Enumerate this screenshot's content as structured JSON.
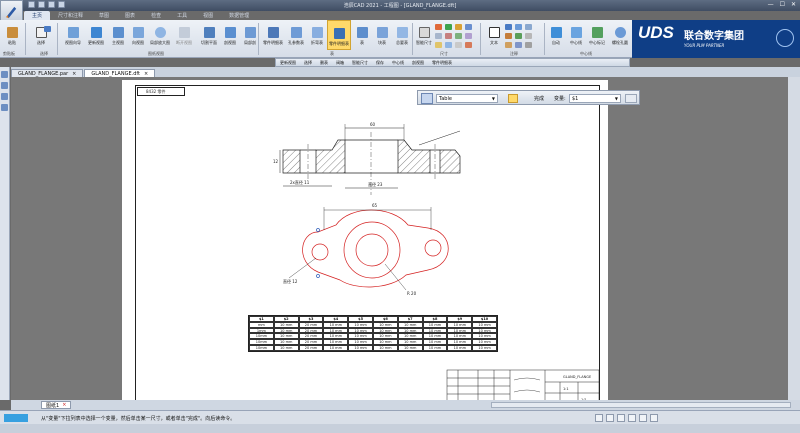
{
  "window": {
    "title": "浩辰CAD 2021 - 工程图 - [GLAND_FLANGE.dft]",
    "controls": [
      "—",
      "☐",
      "✕"
    ]
  },
  "tabs": [
    "主页",
    "尺寸和注释",
    "草图",
    "图表",
    "检查",
    "工具",
    "视图",
    "数据管理"
  ],
  "ribbon": {
    "buttons": [
      "粘贴",
      "选择",
      "视图向导",
      "更新视图",
      "主视图",
      "向视图",
      "局部放大图",
      "断开视图",
      "切割平面",
      "剖视图",
      "局部剖",
      "零件明细表",
      "孔参数表",
      "折弯表",
      "零件明细表",
      "表",
      "块表",
      "总要表",
      "智能尺寸",
      "文本",
      "自动",
      "中心线",
      "中心标记",
      "螺栓孔圆"
    ],
    "groups": [
      "剪贴板",
      "选择",
      "图纸视图",
      "表",
      "尺寸",
      "注释",
      "中心线"
    ]
  },
  "brand": {
    "logo": "UDS",
    "cn": "联合数字集团",
    "en": "YOUR PLM PARTNER"
  },
  "command_bar": [
    "更新视图",
    "选择",
    "删表",
    "阀箱",
    "智能尺寸",
    "保存",
    "中心线",
    "剖视图",
    "零件明细表"
  ],
  "doc_tabs": [
    "GLAND_FLANGE.par",
    "GLAND_FLANGE.dft"
  ],
  "property_bar": {
    "type_value": "Table",
    "label_done": "完成",
    "label_var": "变量:",
    "var_value": "$1"
  },
  "sheet_tab": "图纸1",
  "status_text": "从\"变量\"下拉列表中选择一个变量，然后单击某一尺寸，或者单击\"完成\"。向后读命令。",
  "drawing": {
    "tag": "8432 零件",
    "dims": {
      "top": "60",
      "left": "12",
      "bottom_a": "2x直径 11",
      "bottom_b": "直径 23",
      "plan_top": "65",
      "plan_left": "直径 12",
      "plan_bottom": "R 20"
    }
  },
  "table": {
    "headers": [
      "$1",
      "$2",
      "$3",
      "$4",
      "$5",
      "$6",
      "$7",
      "$8",
      "$9",
      "$10"
    ],
    "rows": [
      [
        "mm",
        "10 mm",
        "20 mm",
        "10 mm",
        "10 mm",
        "10 mm",
        "10 mm",
        "10 mm",
        "10 mm",
        "10 mm"
      ],
      [
        "1mm",
        "10 mm",
        "20 mm",
        "10 mm",
        "10 mm",
        "10 mm",
        "10 mm",
        "10 mm",
        "10 mm",
        "10 mm"
      ],
      [
        "10mm",
        "10 mm",
        "20 mm",
        "10 mm",
        "10 mm",
        "10 mm",
        "10 mm",
        "10 mm",
        "10 mm",
        "10 mm"
      ],
      [
        "10mm",
        "10 mm",
        "20 mm",
        "10 mm",
        "10 mm",
        "10 mm",
        "10 mm",
        "10 mm",
        "10 mm",
        "10 mm"
      ],
      [
        "10mm",
        "10 mm",
        "20 mm",
        "10 mm",
        "10 mm",
        "10 mm",
        "10 mm",
        "10 mm",
        "10 mm",
        "10 mm"
      ]
    ]
  },
  "title_block": {
    "name": "GLAND_FLANGE",
    "scale": "1:1",
    "sheet": "1/1"
  },
  "colors": {
    "accent": "#0f3e86",
    "drawing_red": "#d42020",
    "ribbon_highlight": "#ffd96a"
  }
}
